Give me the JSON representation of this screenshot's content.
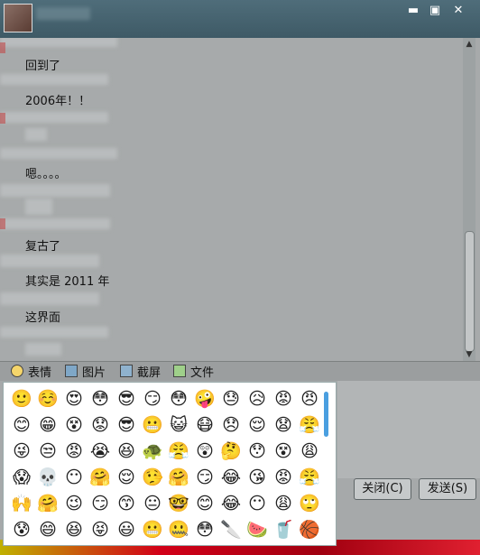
{
  "window": {
    "controls": {
      "minimize": "▬",
      "maximize": "▣",
      "close": "✕"
    }
  },
  "chat": {
    "messages": [
      "回到了",
      "2006年！！",
      "嗯。。。。",
      "复古了",
      "其实是 2011 年",
      "这界面"
    ]
  },
  "toolbar": {
    "emoji": "表情",
    "image": "图片",
    "screenshot": "截屏",
    "file": "文件"
  },
  "buttons": {
    "close": "关闭(C)",
    "send": "发送(S)"
  },
  "emoji_panel": {
    "rows": [
      [
        "🙂",
        "☺️",
        "😍",
        "😳",
        "😎",
        "😏",
        "😳",
        "🤪",
        "😓",
        "😥",
        "😡",
        "😠"
      ],
      [
        "😊",
        "😁",
        "😵",
        "😟",
        "😎",
        "😬",
        "😺",
        "😷",
        "😞",
        "😌",
        "😧",
        "😤"
      ],
      [
        "😜",
        "😒",
        "😡",
        "😭",
        "😆",
        "🐢",
        "😤",
        "😲",
        "🤔",
        "😯",
        "😵",
        "😩"
      ],
      [
        "😱",
        "💀",
        "😶",
        "🤗",
        "😌",
        "🤥",
        "🤗",
        "😏",
        "😂",
        "😘",
        "😡",
        "😤"
      ],
      [
        "🙌",
        "🤗",
        "😉",
        "😏",
        "😙",
        "😐",
        "🤓",
        "😊",
        "😂",
        "😶",
        "😩",
        "🙄"
      ],
      [
        "😰",
        "😄",
        "😆",
        "😝",
        "😃",
        "😬",
        "🤐",
        "😳",
        "🔪",
        "🍉",
        "🥤",
        "🏀"
      ]
    ]
  }
}
